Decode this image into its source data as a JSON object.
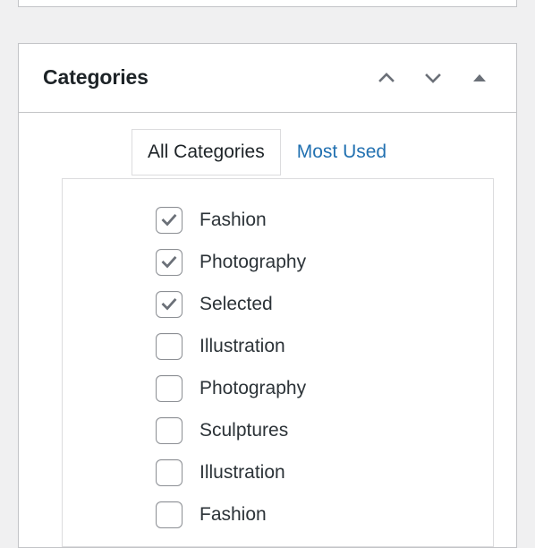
{
  "page": {
    "background_color": "#f0f0f1"
  },
  "metabox_above": {
    "name": "previous-metabox-partial"
  },
  "categories_panel": {
    "title": "Categories",
    "header_actions": [
      {
        "name": "move-up-icon",
        "label": "Move up"
      },
      {
        "name": "move-down-icon",
        "label": "Move down"
      },
      {
        "name": "toggle-panel-icon",
        "label": "Toggle panel"
      }
    ],
    "tabs": [
      {
        "label": "All Categories",
        "active": true
      },
      {
        "label": "Most Used",
        "active": false
      }
    ],
    "link_color": "#2271b1",
    "items": [
      {
        "label": "Fashion",
        "checked": true
      },
      {
        "label": "Photography",
        "checked": true
      },
      {
        "label": "Selected",
        "checked": true
      },
      {
        "label": "Illustration",
        "checked": false
      },
      {
        "label": "Photography",
        "checked": false
      },
      {
        "label": "Sculptures",
        "checked": false
      },
      {
        "label": "Illustration",
        "checked": false
      },
      {
        "label": "Fashion",
        "checked": false
      }
    ]
  }
}
